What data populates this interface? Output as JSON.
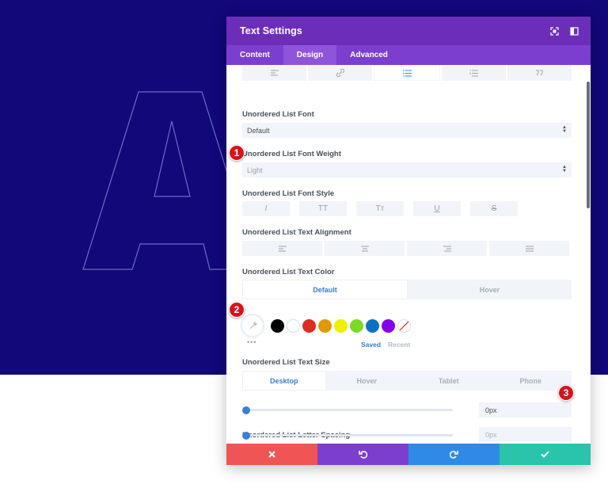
{
  "modal": {
    "title": "Text Settings",
    "tabs": [
      {
        "label": "Content",
        "active": false
      },
      {
        "label": "Design",
        "active": true
      },
      {
        "label": "Advanced",
        "active": false
      }
    ]
  },
  "fields": {
    "font": {
      "label": "Unordered List Font",
      "value": "Default"
    },
    "font_weight": {
      "label": "Unordered List Font Weight",
      "value": "Light"
    },
    "font_style": {
      "label": "Unordered List Font Style",
      "options": [
        "I",
        "TT",
        "Tт",
        "U",
        "S"
      ]
    },
    "alignment": {
      "label": "Unordered List Text Alignment"
    },
    "text_color": {
      "label": "Unordered List Text Color",
      "modes": [
        "Default",
        "Hover"
      ],
      "saved_label": "Saved",
      "recent_label": "Recent",
      "swatches": [
        "#000000",
        "#ffffff",
        "#e02b20",
        "#e09900",
        "#edf000",
        "#7cda24",
        "#0c71c3",
        "#8300e9"
      ]
    },
    "text_size": {
      "label": "Unordered List Text Size",
      "devices": [
        "Desktop",
        "Hover",
        "Tablet",
        "Phone"
      ],
      "value": "0px"
    },
    "letter_spacing": {
      "label": "Unordered List Letter Spacing",
      "value": "0px"
    }
  },
  "badges": {
    "one": "1",
    "two": "2",
    "three": "3"
  },
  "colors": {
    "header": "#6c2eb9",
    "tabs": "#7b3ecf",
    "accent": "#3a7fd6",
    "cancel": "#ef5555",
    "undo": "#7b3ecf",
    "redo": "#2e8ae6",
    "save": "#29c4a9"
  }
}
